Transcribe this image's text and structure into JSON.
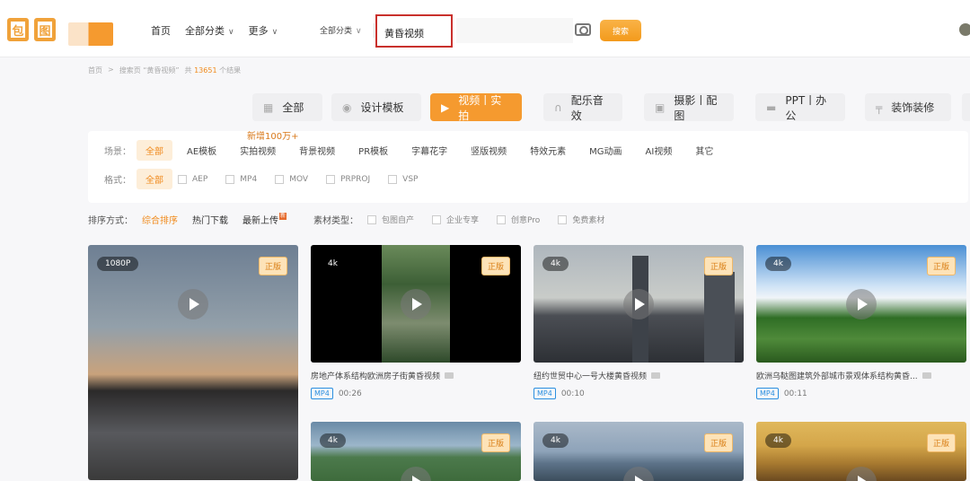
{
  "header": {
    "logo_glyphs": [
      "包",
      "图"
    ],
    "nav": [
      {
        "label": "首页",
        "has_dropdown": false
      },
      {
        "label": "全部分类",
        "has_dropdown": true
      },
      {
        "label": "更多",
        "has_dropdown": true
      }
    ],
    "search": {
      "category": "全部分类",
      "query": "黄昏视频",
      "button": "搜索"
    }
  },
  "breadcrumb": {
    "home": "首页",
    "sep": ">",
    "page": "搜索页 “黄昏视频”",
    "count_prefix": "共",
    "count": "13651",
    "count_suffix": "个结果"
  },
  "categories": [
    {
      "label": "全部",
      "icon": "grid-icon",
      "active": false
    },
    {
      "label": "设计模板",
      "icon": "palette-icon",
      "active": false
    },
    {
      "label": "视频丨实拍",
      "icon": "video-icon",
      "active": true
    },
    {
      "label": "配乐音效",
      "icon": "headphones-icon",
      "active": false
    },
    {
      "label": "摄影丨配图",
      "icon": "camera-icon",
      "active": false
    },
    {
      "label": "PPT丨办公",
      "icon": "folder-icon",
      "active": false
    },
    {
      "label": "装饰装修",
      "icon": "paint-roller-icon",
      "active": false
    }
  ],
  "new_badge": "新增100万+",
  "filters": {
    "scene_label": "场景：",
    "scenes": [
      "全部",
      "AE模板",
      "实拍视频",
      "背景视频",
      "PR模板",
      "字幕花字",
      "竖版视频",
      "特效元素",
      "MG动画",
      "AI视频",
      "其它"
    ],
    "format_label": "格式：",
    "formats_all": "全部",
    "formats": [
      "AEP",
      "MP4",
      "MOV",
      "PRPROJ",
      "VSP"
    ]
  },
  "sort": {
    "label": "排序方式：",
    "options": [
      "综合排序",
      "热门下载",
      "最新上传"
    ],
    "newflag": "新",
    "type_label": "素材类型：",
    "types": [
      "包图自产",
      "企业专享",
      "创意Pro",
      "免费素材"
    ]
  },
  "cards": [
    {
      "res": "1080P",
      "badge": "正版",
      "title": "",
      "format": "",
      "duration": ""
    },
    {
      "res": "4k",
      "badge": "正版",
      "title": "房地产体系结构欧洲房子街黄昏视频",
      "format": "MP4",
      "duration": "00:26"
    },
    {
      "res": "4k",
      "badge": "正版",
      "title": "纽约世贸中心一号大楼黄昏视频",
      "format": "MP4",
      "duration": "00:10"
    },
    {
      "res": "4k",
      "badge": "正版",
      "title": "欧洲乌鞑图建筑外部城市景观体系结构黄昏...",
      "format": "MP4",
      "duration": "00:11"
    },
    {
      "res": "4k",
      "badge": "正版",
      "title": "",
      "format": "",
      "duration": ""
    },
    {
      "res": "4k",
      "badge": "正版",
      "title": "",
      "format": "",
      "duration": ""
    },
    {
      "res": "4k",
      "badge": "正版",
      "title": "",
      "format": "",
      "duration": ""
    }
  ]
}
